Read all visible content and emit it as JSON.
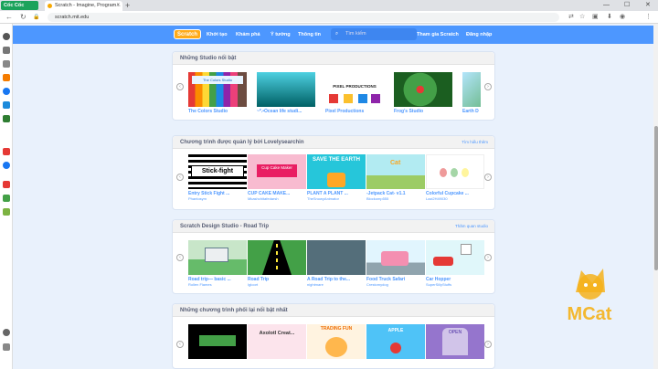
{
  "browser": {
    "brand": "Cốc Cốc",
    "tab_title": "Scratch - Imagine, Program...",
    "url": "scratch.mit.edu"
  },
  "menubar": {
    "logo": "Scratch",
    "items": [
      "Khởi tạo",
      "Khám phá",
      "Ý tưởng",
      "Thông tin"
    ],
    "search_placeholder": "Tìm kiếm",
    "join": "Tham gia Scratch",
    "signin": "Đăng nhập"
  },
  "sections": [
    {
      "title": "Những Studio nổi bật",
      "link": "",
      "cards": [
        {
          "title": "The Colors Studio",
          "sub": "",
          "art": "The Colors Studio"
        },
        {
          "title": "~*.•Ocean life studi...",
          "sub": "",
          "art": "ocean"
        },
        {
          "title": "Pixel Productions",
          "sub": "",
          "art": "PIXEL PRODUCTIONS"
        },
        {
          "title": "Frog's Studio",
          "sub": "",
          "art": "frog"
        },
        {
          "title": "Earth D",
          "sub": "",
          "art": "earth"
        }
      ]
    },
    {
      "title": "Chương trình được quản lý bởi Lovelysearchin",
      "link": "Tìm hiểu thêm",
      "cards": [
        {
          "title": "Entry Stick Fight ...",
          "sub": "Phantosym",
          "art": "Stick-fight"
        },
        {
          "title": "CUP CAKE MAKE...",
          "sub": "Mkashchitafedarsh",
          "art": "Cup Cake Maker"
        },
        {
          "title": "PLANT A PLANT ...",
          "sub": "TheSnowyAnimator",
          "art": "SAVE THE EARTH"
        },
        {
          "title": "-Jetpack Cat- v1.1",
          "sub": "Blockomp555",
          "art": "Cat"
        },
        {
          "title": "Colorful Cupcake ...",
          "sub": "Lazi2H49030",
          "art": "eggs"
        }
      ]
    },
    {
      "title": "Scratch Design Studio - Road Trip",
      "link": "Thăm quan studio",
      "cards": [
        {
          "title": "Road trip— basic ...",
          "sub": "Rollen Flames",
          "art": "road"
        },
        {
          "title": "Road Trip",
          "sub": "Igloort",
          "art": "road2"
        },
        {
          "title": "A Road Trip to the...",
          "sub": "nightmare",
          "art": "sketch"
        },
        {
          "title": "Food Truck Safari",
          "sub": "Crestomydog",
          "art": "truck"
        },
        {
          "title": "Car Hopper",
          "sub": "SuperSillyStuffs",
          "art": "car"
        }
      ]
    },
    {
      "title": "Những chương trình phối lại nổi bật nhất",
      "link": "",
      "cards": [
        {
          "title": "",
          "sub": "",
          "art": ""
        },
        {
          "title": "",
          "sub": "",
          "art": "Axolotl Creat..."
        },
        {
          "title": "",
          "sub": "",
          "art": "TRADING FUN"
        },
        {
          "title": "",
          "sub": "",
          "art": "APPLE"
        },
        {
          "title": "",
          "sub": "",
          "art": "OPEN"
        }
      ]
    }
  ],
  "watermark": "MCat",
  "colors": {
    "menubar": "#4d97ff",
    "link": "#4d97ff",
    "logo": "#ffab19"
  }
}
